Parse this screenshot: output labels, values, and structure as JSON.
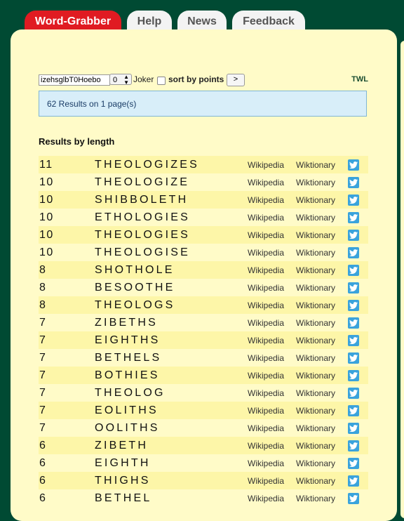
{
  "tabs": [
    {
      "label": "Word-Grabber",
      "active": true
    },
    {
      "label": "Help"
    },
    {
      "label": "News"
    },
    {
      "label": "Feedback"
    }
  ],
  "search": {
    "letters": "izehsglbT0Hoebo",
    "joker_value": "0",
    "joker_label": "Joker",
    "sort_label": "sort by points",
    "go_label": ">",
    "dictionary": "TWL"
  },
  "results_summary": "62 Results on 1 page(s)",
  "section_title": "Results by length",
  "links": {
    "wikipedia": "Wikipedia",
    "wiktionary": "Wiktionary"
  },
  "icons": {
    "share": "twitter-icon"
  },
  "colors": {
    "brand_red": "#e01b22",
    "background": "#004a33",
    "panel": "#fffbc8",
    "alt_row": "#fdf6a8",
    "twitter": "#3aa3dc"
  },
  "results": [
    {
      "length": "11",
      "word": "THEOLOGIZES"
    },
    {
      "length": "10",
      "word": "THEOLOGIZE"
    },
    {
      "length": "10",
      "word": "SHIBBOLETH"
    },
    {
      "length": "10",
      "word": "ETHOLOGIES"
    },
    {
      "length": "10",
      "word": "THEOLOGIES"
    },
    {
      "length": "10",
      "word": "THEOLOGISE"
    },
    {
      "length": "8",
      "word": "SHOTHOLE"
    },
    {
      "length": "8",
      "word": "BESOOTHE"
    },
    {
      "length": "8",
      "word": "THEOLOGS"
    },
    {
      "length": "7",
      "word": "ZIBETHS"
    },
    {
      "length": "7",
      "word": "EIGHTHS"
    },
    {
      "length": "7",
      "word": "BETHELS"
    },
    {
      "length": "7",
      "word": "BOTHIES"
    },
    {
      "length": "7",
      "word": "THEOLOG"
    },
    {
      "length": "7",
      "word": "EOLITHS"
    },
    {
      "length": "7",
      "word": "OOLITHS"
    },
    {
      "length": "6",
      "word": "ZIBETH"
    },
    {
      "length": "6",
      "word": "EIGHTH"
    },
    {
      "length": "6",
      "word": "THIGHS"
    },
    {
      "length": "6",
      "word": "BETHEL"
    }
  ]
}
